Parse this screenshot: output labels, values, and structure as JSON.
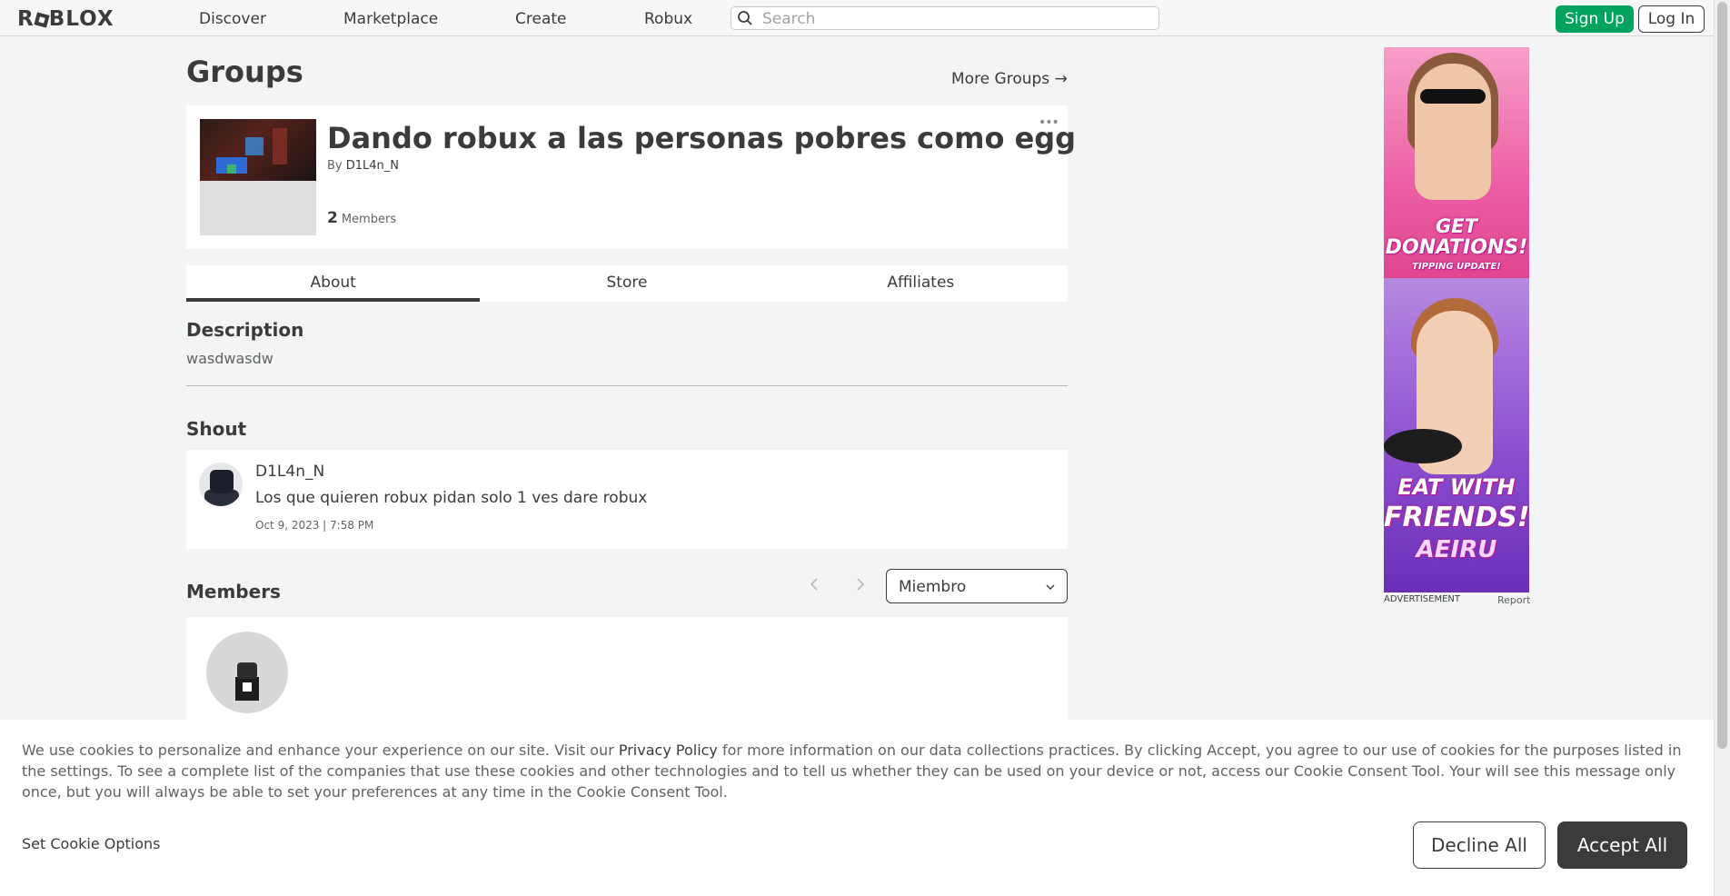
{
  "topbar": {
    "logo": "RBLOX",
    "nav": [
      "Discover",
      "Marketplace",
      "Create",
      "Robux"
    ],
    "search_placeholder": "Search",
    "signup_label": "Sign Up",
    "login_label": "Log In"
  },
  "page": {
    "title": "Groups",
    "more_groups": "More Groups →"
  },
  "group": {
    "name": "Dando robux a las personas pobres como egg",
    "owner_prefix": "By ",
    "owner": "D1L4n_N",
    "member_count": "2",
    "member_label": "Members",
    "more_menu": "•••"
  },
  "tabs": [
    {
      "label": "About",
      "active": true
    },
    {
      "label": "Store",
      "active": false
    },
    {
      "label": "Affiliates",
      "active": false
    }
  ],
  "description": {
    "heading": "Description",
    "text": "wasdwasdw"
  },
  "shout": {
    "heading": "Shout",
    "user": "D1L4n_N",
    "message": "Los que quieren robux pidan solo 1 ves dare robux",
    "date": "Oct 9, 2023 | 7:58 PM"
  },
  "members": {
    "heading": "Members",
    "role_selected": "Miembro"
  },
  "ad": {
    "top_text_1": "GET",
    "top_text_2": "DONATIONS!",
    "top_text_3": "TIPPING UPDATE!",
    "bottom_text_1": "EAT WITH",
    "bottom_text_2": "FRIENDS!",
    "bottom_text_3": "AEIRU",
    "label": "ADVERTISEMENT",
    "report": "Report"
  },
  "cookie": {
    "text_before": "We use cookies to personalize and enhance your experience on our site. Visit our ",
    "policy_link": "Privacy Policy",
    "text_after": " for more information on our data collections practices. By clicking Accept, you agree to our use of cookies for the purposes listed in the settings. To see a complete list of the companies that use these cookies and other technologies and to tell us whether they can be used on your device or not, access our Cookie Consent Tool. Your will see this message only once, but you will always be able to set your preferences at any time in the Cookie Consent Tool.",
    "set_options": "Set Cookie Options",
    "decline": "Decline All",
    "accept": "Accept All"
  }
}
